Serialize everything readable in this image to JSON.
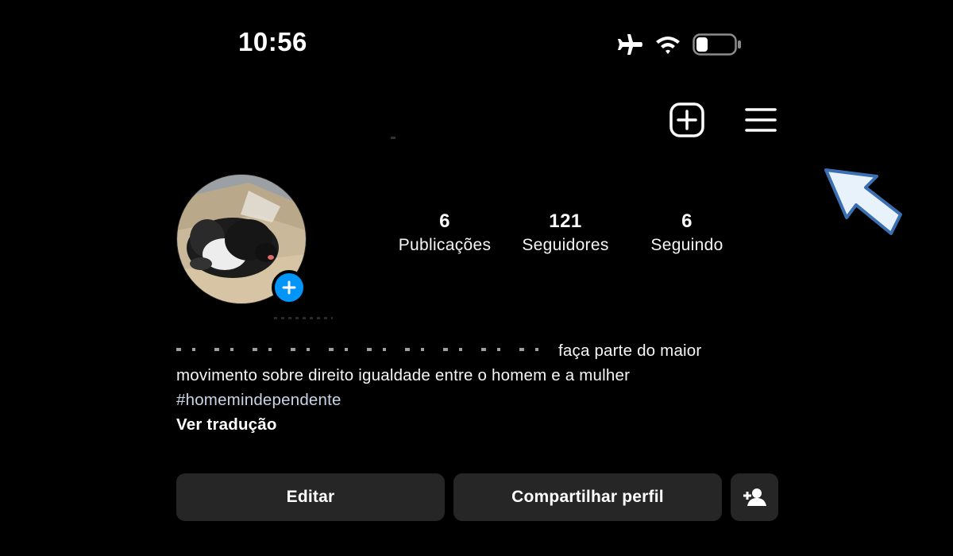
{
  "status_bar": {
    "time": "10:56",
    "icons": [
      "airplane-icon",
      "wifi-icon",
      "battery-icon"
    ]
  },
  "header": {
    "actions": [
      "new-post-icon",
      "menu-icon"
    ]
  },
  "profile": {
    "avatar_description": "profile photo",
    "stats": [
      {
        "count": "6",
        "label": "Publicações"
      },
      {
        "count": "121",
        "label": "Seguidores"
      },
      {
        "count": "6",
        "label": "Seguindo"
      }
    ],
    "bio": {
      "line1_visible": "faça parte do maior",
      "line2": "movimento sobre direito igualdade entre o homem e a mulher",
      "hashtag": "#homemindependente",
      "translate": "Ver tradução"
    }
  },
  "buttons": {
    "edit": "Editar",
    "share": "Compartilhar perfil"
  },
  "colors": {
    "background": "#000000",
    "button_bg": "#262626",
    "accent": "#0095f6",
    "hashtag": "#c9d4e6"
  }
}
